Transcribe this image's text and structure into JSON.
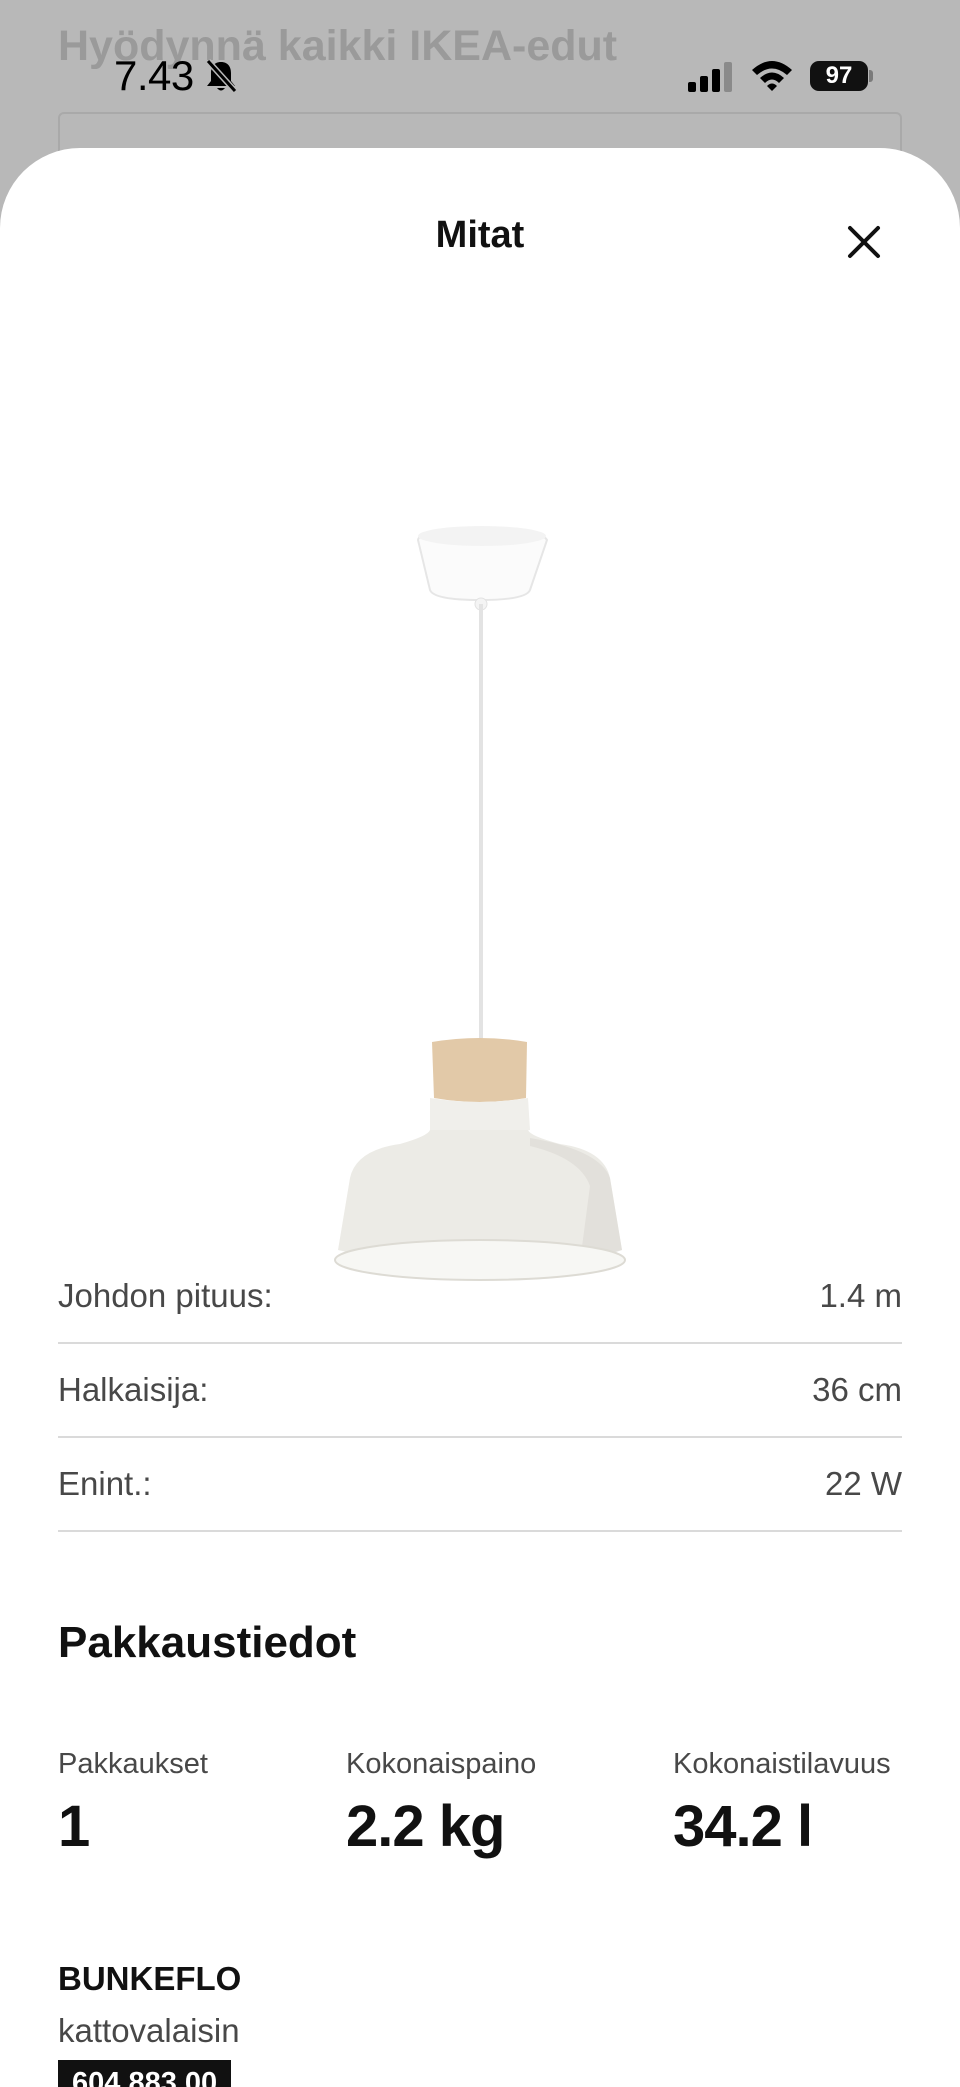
{
  "background": {
    "title": "Hyödynnä kaikki IKEA-edut"
  },
  "status_bar": {
    "time": "7.43",
    "battery": "97"
  },
  "sheet": {
    "title": "Mitat",
    "dimensions": [
      {
        "label": "Johdon pituus:",
        "value": "1.4 m"
      },
      {
        "label": "Halkaisija:",
        "value": "36 cm"
      },
      {
        "label": "Enint.:",
        "value": "22 W"
      }
    ],
    "package": {
      "heading": "Pakkaustiedot",
      "columns": [
        {
          "label": "Pakkaukset",
          "value": "1"
        },
        {
          "label": "Kokonaispaino",
          "value": "2.2 kg"
        },
        {
          "label": "Kokonaistilavuus",
          "value": "34.2 l"
        }
      ]
    },
    "product": {
      "name": "BUNKEFLO",
      "type": "kattovalaisin",
      "article_number": "604.883.00"
    }
  },
  "icons": {
    "close": "close-icon",
    "bell": "bell-slash-icon",
    "signal": "signal-icon",
    "wifi": "wifi-icon"
  },
  "colors": {
    "shade": "#ecebe6",
    "wood": "#e2c9a8"
  }
}
